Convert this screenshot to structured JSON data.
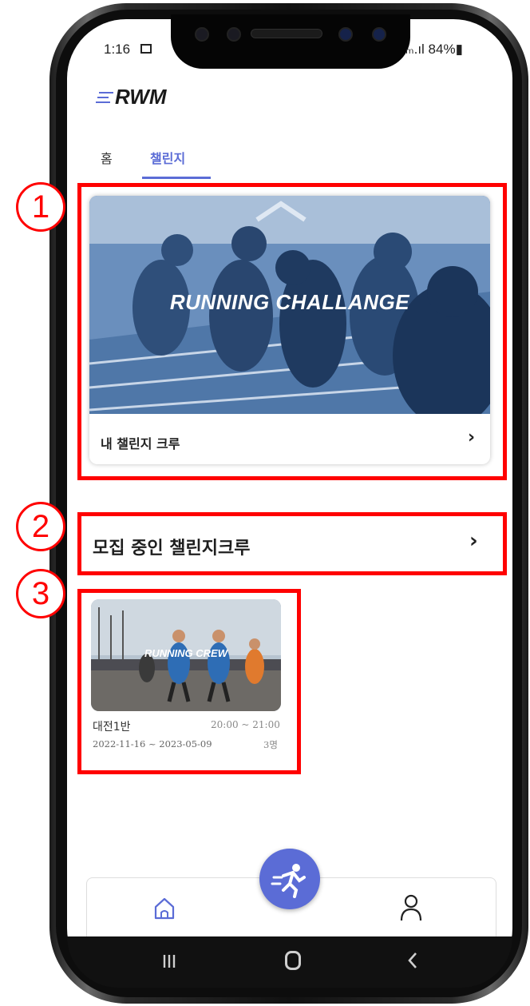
{
  "status_bar": {
    "time": "1:16",
    "right": "ₘ.ıl 84%▮"
  },
  "app": {
    "logo_text": "RWM"
  },
  "tabs": [
    {
      "label": "홈",
      "active": false
    },
    {
      "label": "챌린지",
      "active": true
    }
  ],
  "annotations": [
    "1",
    "2",
    "3"
  ],
  "my_challenge_card": {
    "banner_text": "RUNNING CHALLANGE",
    "label": "내 챌린지 크루",
    "chevron": "›"
  },
  "recruiting_section": {
    "label": "모집 중인 챌린지크루",
    "chevron": "›"
  },
  "crew_card": {
    "image_text": "RUNNING CREW",
    "name": "대전1반",
    "time": "20:00 ~ 21:00",
    "dates": "2022-11-16 ~ 2023-05-09",
    "members": "3명"
  },
  "bottom_nav": {
    "items": [
      {
        "icon": "home-icon"
      },
      {
        "icon": "runner-icon"
      },
      {
        "icon": "profile-icon"
      }
    ]
  },
  "colors": {
    "accent": "#5b6cd6",
    "annotation": "#ff0000",
    "banner_tint": "#5b82b3"
  }
}
